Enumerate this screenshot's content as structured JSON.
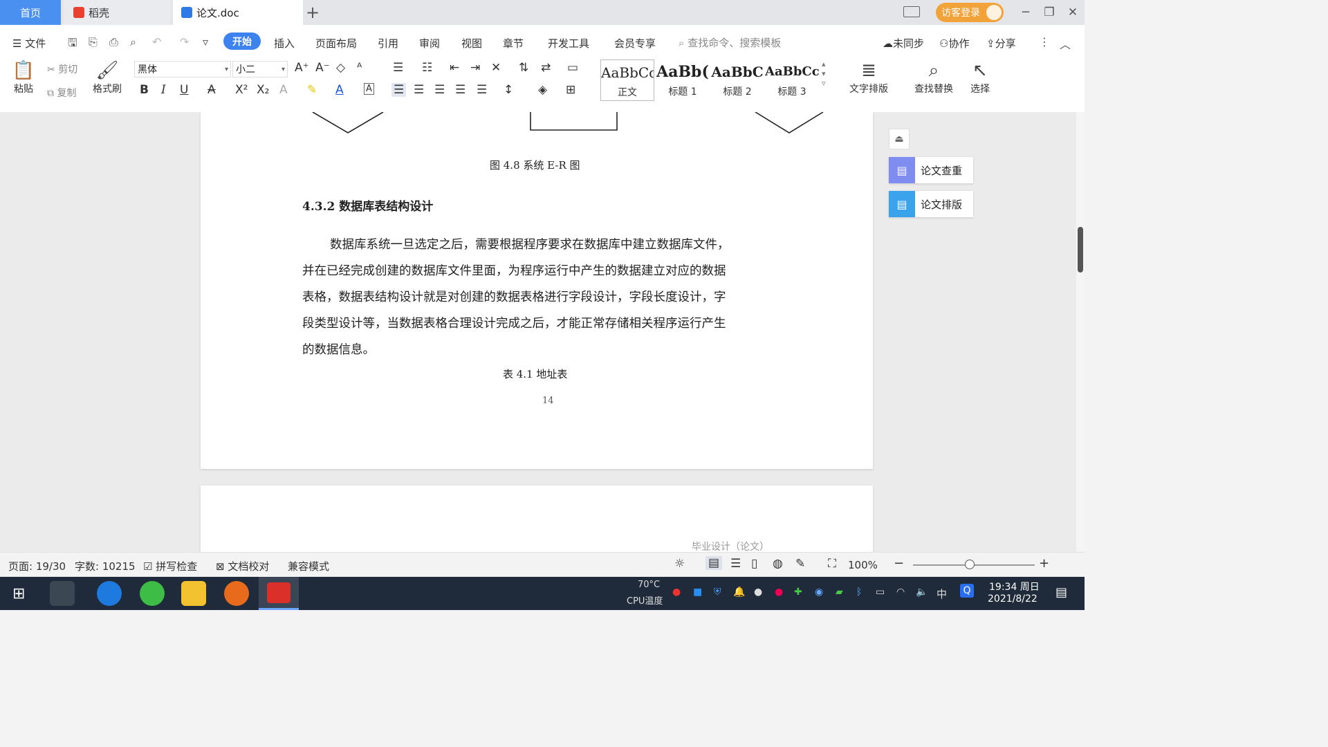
{
  "tabs": {
    "home": "首页",
    "daoke": "稻壳",
    "doc": "论文.doc",
    "new_tab": "+"
  },
  "login": "访客登录",
  "menu": {
    "file": "文件",
    "start": "开始",
    "insert": "插入",
    "layout": "页面布局",
    "reference": "引用",
    "review": "审阅",
    "view": "视图",
    "chapter": "章节",
    "devtools": "开发工具",
    "member": "会员专享",
    "search_placeholder": "查找命令、搜索模板",
    "unsynced": "未同步",
    "collab": "协作",
    "share": "分享"
  },
  "ribbon": {
    "paste": "粘贴",
    "cut": "剪切",
    "copy": "复制",
    "format_painter": "格式刷",
    "font_name": "黑体",
    "font_size": "小二",
    "styles": [
      {
        "preview": "AaBbCcI",
        "name": "正文"
      },
      {
        "preview": "AaBb(",
        "name": "标题 1"
      },
      {
        "preview": "AaBbC",
        "name": "标题 2"
      },
      {
        "preview": "AaBbCc",
        "name": "标题 3"
      }
    ],
    "text_layout": "文字排版",
    "find_replace": "查找替换",
    "select": "选择"
  },
  "document": {
    "figure_caption": "图 4.8  系统 E-R 图",
    "section_heading": "4.3.2  数据库表结构设计",
    "paragraph_lines": [
      "数据库系统一旦选定之后，需要根据程序要求在数据库中建立数据库文件，",
      "并在已经完成创建的数据库文件里面，为程序运行中产生的数据建立对应的数据",
      "表格，数据表结构设计就是对创建的数据表格进行字段设计，字段长度设计，字",
      "段类型设计等，当数据表格合理设计完成之后，才能正常存储相关程序运行产生",
      "的数据信息。"
    ],
    "table_caption": "表 4.1 地址表",
    "page_number": "14",
    "page2_header": "毕业设计（论文）"
  },
  "side_panel": {
    "check": "论文查重",
    "layout": "论文排版"
  },
  "status": {
    "page": "页面: 19/30",
    "words": "字数: 10215",
    "spell_check": "拼写检查",
    "proofread": "文档校对",
    "compat": "兼容模式",
    "zoom": "100%"
  },
  "taskbar": {
    "cpu_temp": "70°C",
    "cpu_label": "CPU温度",
    "ime": "中",
    "time": "19:34 周日",
    "date": "2021/8/22"
  },
  "colors": {
    "accent": "#3d83f0",
    "login": "#f1a33a",
    "taskbar": "#1f2b3a"
  }
}
